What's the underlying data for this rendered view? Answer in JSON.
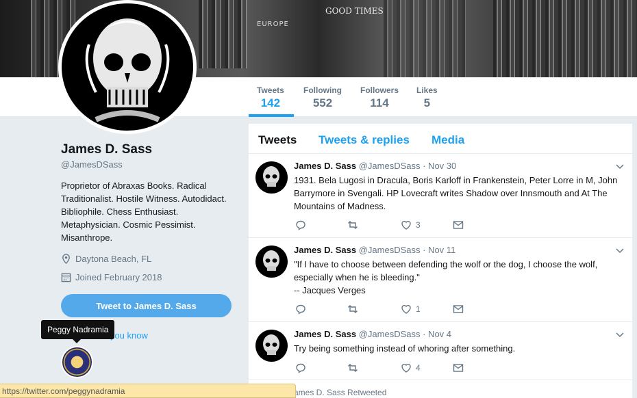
{
  "banner": {
    "text1": "EUROPE",
    "text2": "GOOD TIMES"
  },
  "nav": {
    "stats": [
      {
        "label": "Tweets",
        "value": "142"
      },
      {
        "label": "Following",
        "value": "552"
      },
      {
        "label": "Followers",
        "value": "114"
      },
      {
        "label": "Likes",
        "value": "5"
      }
    ]
  },
  "profile": {
    "name": "James D. Sass",
    "handle": "@JamesDSass",
    "bio": "Proprietor of Abraxas Books. Radical\nTraditionalist. Hostile Witness. Autodidact.\nBibliophile. Chess Enthusiast.\nMetaphysician. Cosmic Pessimist.\nMisanthrope.",
    "location": "Daytona Beach, FL",
    "joined": "Joined February 2018",
    "tweet_button": "Tweet to James D. Sass",
    "followers_you_know": "r you know"
  },
  "tooltip": {
    "text": "Peggy Nadramia"
  },
  "statusbar": {
    "url": "https://twitter.com/peggynadramia"
  },
  "timeline": {
    "tabs": [
      "Tweets",
      "Tweets & replies",
      "Media"
    ],
    "tweets": [
      {
        "name": "James D. Sass",
        "handle": "@JamesDSass",
        "date": "· Nov 30",
        "text": "1931. Bela Lugosi in Dracula, Boris Karloff in Frankenstein, Peter Lorre in M, John Barrymore in Svengali. HP Lovecraft writes Shadow over Innsmouth and At The Mountains of Madness.",
        "likes": "3"
      },
      {
        "name": "James D. Sass",
        "handle": "@JamesDSass",
        "date": "· Nov 11",
        "text": "\"If I have to choose between defending the wolf or the dog, I choose the wolf, especially when he is bleeding.\"\n-- Jacques Verges",
        "likes": "1"
      },
      {
        "name": "James D. Sass",
        "handle": "@JamesDSass",
        "date": "· Nov 4",
        "text": "Try being something instead of whoring after something.",
        "likes": "4"
      }
    ],
    "retweeted": "ames D. Sass Retweeted"
  },
  "colors": {
    "accent": "#1da1f2",
    "button": "#53a9ea",
    "background": "#e6ecf0"
  }
}
